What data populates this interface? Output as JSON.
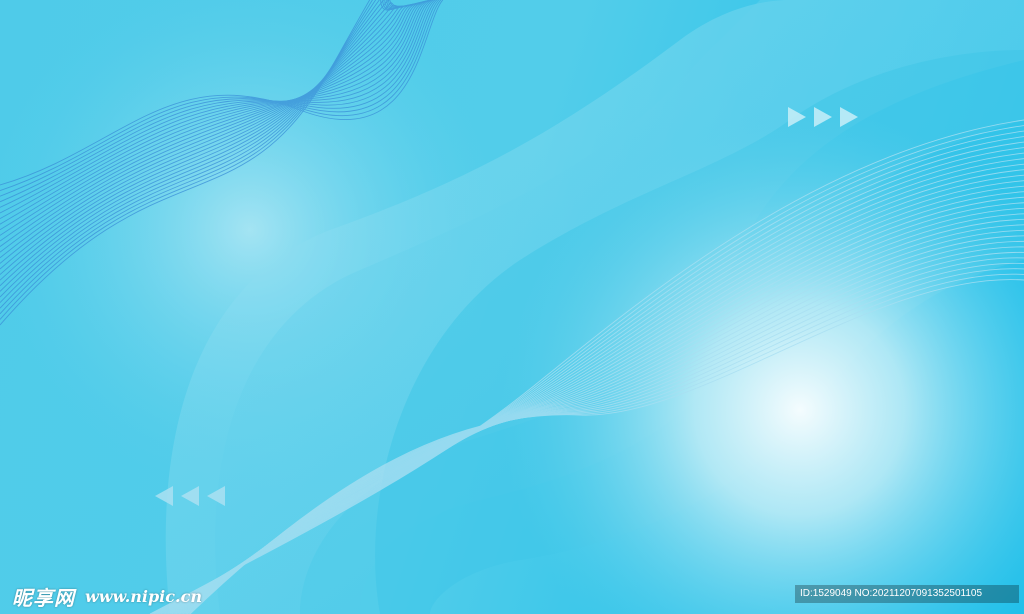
{
  "colors": {
    "base": "#2fc3e8",
    "glow": "#f2fbfd",
    "wave_line_left": "#3a8fd8",
    "wave_line_right": "#b6e6f3",
    "arrow": "#d2f0f8"
  },
  "decor": {
    "arrows_right_icon": "triple-right-arrow-icon",
    "arrows_left_icon": "triple-left-arrow-icon"
  },
  "watermark": {
    "site_name": "昵享网",
    "site_url": "www.nipic.cn",
    "id_text": "ID:1529049 NO:20211207091352501105"
  }
}
